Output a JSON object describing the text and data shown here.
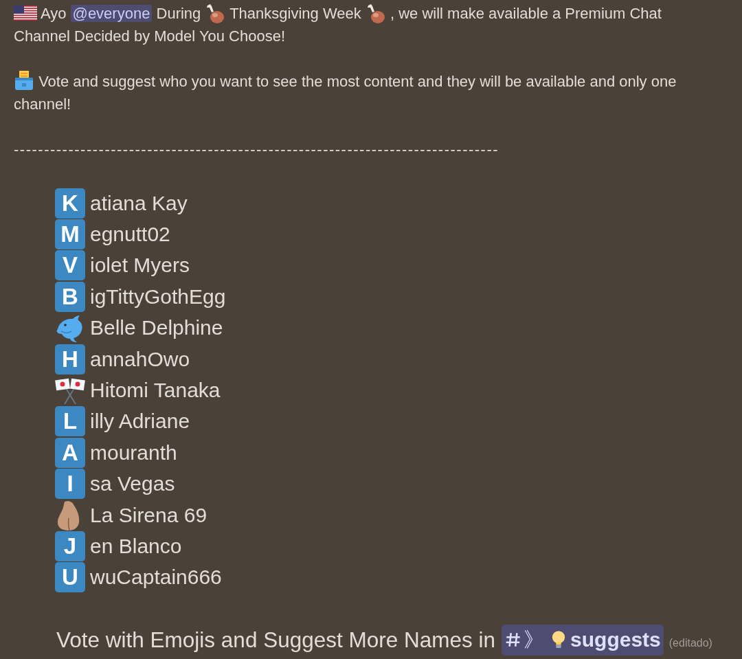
{
  "message": {
    "paragraphs": [
      {
        "segments": [
          {
            "kind": "flag"
          },
          {
            "kind": "text",
            "text": "Ayo"
          },
          {
            "kind": "mention",
            "text": "@everyone"
          },
          {
            "kind": "text",
            "text": "During"
          },
          {
            "kind": "drumstick"
          },
          {
            "kind": "text",
            "text": "Thanksgiving Week"
          },
          {
            "kind": "drumstick"
          },
          {
            "kind": "text",
            "text": ", we will make available a Premium Chat Channel Decided by Model You Choose!"
          }
        ]
      },
      {
        "segments": [
          {
            "kind": "ballot"
          },
          {
            "kind": "text",
            "text": "Vote and suggest who you want to see the most content and they will be available and only one channel!"
          }
        ]
      }
    ],
    "divider": "--------------------------------------------------------------------------------",
    "names": [
      {
        "kind": "letter",
        "letter": "K",
        "text": "atiana Kay"
      },
      {
        "kind": "letter",
        "letter": "M",
        "text": "egnutt02"
      },
      {
        "kind": "letter",
        "letter": "V",
        "text": "iolet Myers"
      },
      {
        "kind": "letter",
        "letter": "B",
        "text": "igTittyGothEgg"
      },
      {
        "kind": "dolphin",
        "text": "Belle Delphine"
      },
      {
        "kind": "letter",
        "letter": "H",
        "text": "annahOwo"
      },
      {
        "kind": "flags",
        "text": "Hitomi Tanaka"
      },
      {
        "kind": "letter",
        "letter": "L",
        "text": "illy Adriane"
      },
      {
        "kind": "letter",
        "letter": "A",
        "text": "mouranth"
      },
      {
        "kind": "letter",
        "letter": "I",
        "text": "sa Vegas"
      },
      {
        "kind": "image",
        "text": "La Sirena 69"
      },
      {
        "kind": "letter",
        "letter": "J",
        "text": "en Blanco"
      },
      {
        "kind": "letter",
        "letter": "U",
        "text": "wuCaptain666"
      }
    ],
    "footer": {
      "text": "Vote with Emojis and Suggest More Names in",
      "channel": {
        "prefix": "》",
        "name": "suggests"
      },
      "edited": "(editado)"
    }
  }
}
